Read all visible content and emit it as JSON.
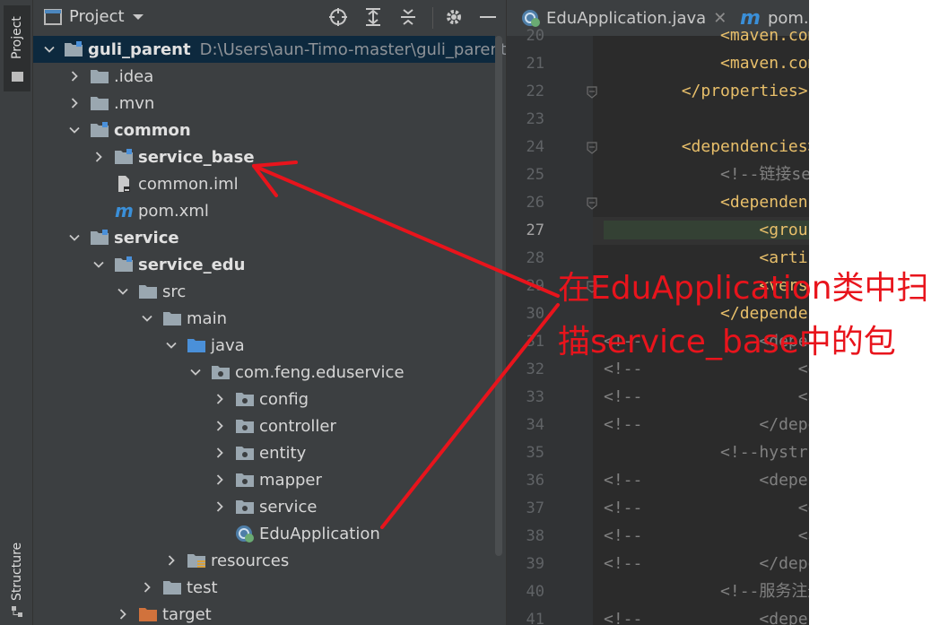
{
  "toolwindow": {
    "project_tab": "Project",
    "structure_tab": "Structure"
  },
  "panel": {
    "title": "Project"
  },
  "tree": [
    {
      "label": "guli_parent",
      "path": "D:\\Users\\aun-Timo-master\\guli_parent",
      "depth": 0,
      "expanded": true,
      "icon": "module-folder",
      "bold": true,
      "selected": true
    },
    {
      "label": ".idea",
      "depth": 1,
      "expanded": false,
      "icon": "folder"
    },
    {
      "label": ".mvn",
      "depth": 1,
      "expanded": false,
      "icon": "folder"
    },
    {
      "label": "common",
      "depth": 1,
      "expanded": true,
      "icon": "module-folder",
      "bold": true
    },
    {
      "label": "service_base",
      "depth": 2,
      "expanded": false,
      "icon": "module-folder",
      "bold": true
    },
    {
      "label": "common.iml",
      "depth": 2,
      "icon": "iml-file"
    },
    {
      "label": "pom.xml",
      "depth": 2,
      "icon": "maven-file"
    },
    {
      "label": "service",
      "depth": 1,
      "expanded": true,
      "icon": "module-folder",
      "bold": true
    },
    {
      "label": "service_edu",
      "depth": 2,
      "expanded": true,
      "icon": "module-folder",
      "bold": true
    },
    {
      "label": "src",
      "depth": 3,
      "expanded": true,
      "icon": "folder"
    },
    {
      "label": "main",
      "depth": 4,
      "expanded": true,
      "icon": "folder"
    },
    {
      "label": "java",
      "depth": 5,
      "expanded": true,
      "icon": "source-folder"
    },
    {
      "label": "com.feng.eduservice",
      "depth": 6,
      "expanded": true,
      "icon": "package"
    },
    {
      "label": "config",
      "depth": 7,
      "expanded": false,
      "icon": "package"
    },
    {
      "label": "controller",
      "depth": 7,
      "expanded": false,
      "icon": "package"
    },
    {
      "label": "entity",
      "depth": 7,
      "expanded": false,
      "icon": "package"
    },
    {
      "label": "mapper",
      "depth": 7,
      "expanded": false,
      "icon": "package"
    },
    {
      "label": "service",
      "depth": 7,
      "expanded": false,
      "icon": "package"
    },
    {
      "label": "EduApplication",
      "depth": 7,
      "icon": "spring-class"
    },
    {
      "label": "resources",
      "depth": 5,
      "expanded": false,
      "icon": "resources-folder"
    },
    {
      "label": "test",
      "depth": 4,
      "expanded": false,
      "icon": "folder"
    },
    {
      "label": "target",
      "depth": 3,
      "expanded": false,
      "icon": "excluded-folder"
    }
  ],
  "editor": {
    "tabs": [
      {
        "label": "EduApplication.java",
        "icon": "spring-class",
        "closable": true
      },
      {
        "label": "pom.x",
        "icon": "maven-file",
        "closable": false
      }
    ],
    "lines": [
      {
        "num": "20",
        "text": "            <maven.compi",
        "style": "tag"
      },
      {
        "num": "21",
        "text": "            <maven.compi",
        "style": "tag"
      },
      {
        "num": "22",
        "text": "        </properties>",
        "style": "tag"
      },
      {
        "num": "23",
        "text": "",
        "style": "tag"
      },
      {
        "num": "24",
        "text": "        <dependencies>",
        "style": "tag"
      },
      {
        "num": "25",
        "text": "            <!--链接serv",
        "style": "cmt"
      },
      {
        "num": "26",
        "text": "            <dependency>",
        "style": "tag"
      },
      {
        "num": "27",
        "text": "                <groupId",
        "style": "gi"
      },
      {
        "num": "28",
        "text": "                <artifac",
        "style": "tag"
      },
      {
        "num": "29",
        "text": "                <version",
        "style": "tag"
      },
      {
        "num": "30",
        "text": "            </dependency",
        "style": "tag"
      },
      {
        "num": "31",
        "text": "<!--            <depend",
        "style": "cmt"
      },
      {
        "num": "32",
        "text": "<!--                <gro",
        "style": "cmt"
      },
      {
        "num": "33",
        "text": "<!--                <art",
        "style": "cmt"
      },
      {
        "num": "34",
        "text": "<!--            </depend",
        "style": "cmt"
      },
      {
        "num": "35",
        "text": "            <!--hystrix",
        "style": "cmt"
      },
      {
        "num": "36",
        "text": "<!--            <depende",
        "style": "cmt"
      },
      {
        "num": "37",
        "text": "<!--                <gro",
        "style": "cmt"
      },
      {
        "num": "38",
        "text": "<!--                <art",
        "style": "cmt"
      },
      {
        "num": "39",
        "text": "<!--            </depende",
        "style": "cmt"
      },
      {
        "num": "40",
        "text": "            <!--服务注册-",
        "style": "cmt"
      },
      {
        "num": "41",
        "text": "<!--            <depende",
        "style": "cmt"
      }
    ],
    "current_line": "27"
  },
  "annotation": {
    "line1": "在EduApplication类中扫",
    "line2": "描service_base中的包",
    "color": "#e8141c"
  }
}
